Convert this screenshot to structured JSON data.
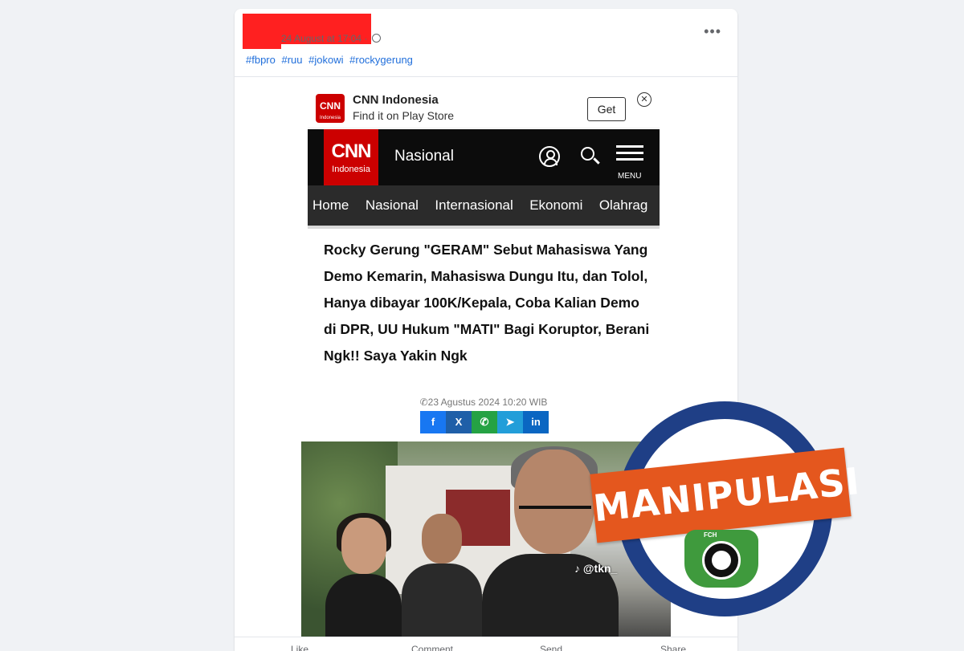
{
  "post": {
    "timestamp": "24 August at 17:04 ·",
    "hashtags": [
      "#fbpro",
      "#ruu",
      "#jokowi",
      "#rockygerung"
    ],
    "more_label": "•••"
  },
  "app_banner": {
    "logo_text": "CNN",
    "logo_sub": "Indonesia",
    "name": "CNN Indonesia",
    "subtitle": "Find it on Play Store",
    "get_label": "Get",
    "close_label": "✕"
  },
  "cnn_nav": {
    "logo_text": "CNN",
    "logo_sub": "Indonesia",
    "section": "Nasional",
    "menu_label": "MENU",
    "tabs": [
      "Home",
      "Nasional",
      "Internasional",
      "Ekonomi",
      "Olahrag"
    ]
  },
  "article": {
    "headline": "Rocky Gerung \"GERAM\"  Sebut Mahasiswa Yang Demo Kemarin, Mahasiswa Dungu Itu, dan Tolol, Hanya dibayar 100K/Kepala, Coba Kalian Demo di DPR, UU Hukum \"MATI\" Bagi Koruptor, Berani Ngk!! Saya Yakin Ngk",
    "date": "23 Agustus 2024 10:20 WIB",
    "share": [
      {
        "label": "f",
        "color": "#1877f2"
      },
      {
        "label": "X",
        "color": "#1f5fa8"
      },
      {
        "label": "✆",
        "color": "#25a244"
      },
      {
        "label": "➤",
        "color": "#229ed9"
      },
      {
        "label": "in",
        "color": "#0a66c2"
      }
    ],
    "video_watermark": "♪ @tkn_"
  },
  "actions": [
    "Like",
    "Comment",
    "Send",
    "Share"
  ],
  "stamp": {
    "label": "MANIPULASI",
    "badge_text": "FCH"
  }
}
